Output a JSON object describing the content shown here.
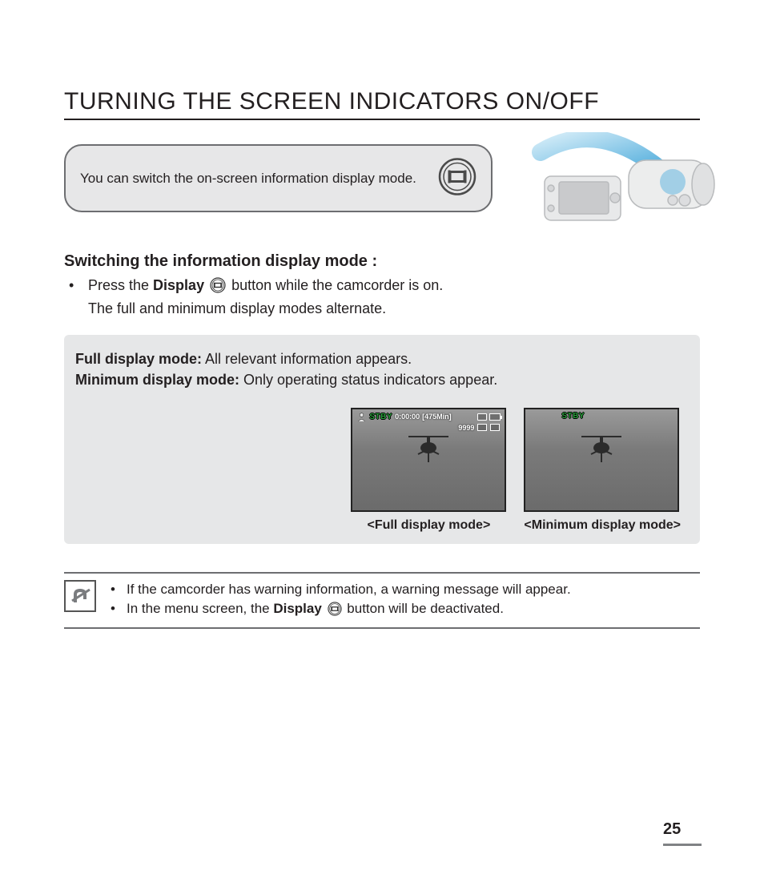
{
  "page": {
    "title": "TURNING THE SCREEN INDICATORS ON/OFF",
    "number": "25"
  },
  "intro": {
    "text": "You can switch the on-screen information display mode."
  },
  "section": {
    "heading": "Switching the information display mode :",
    "line1_a": "Press the ",
    "line1_bold": "Display",
    "line1_b": " button while the camcorder is on.",
    "line2": "The full and minimum display modes alternate."
  },
  "modes": {
    "full_label": "Full display mode:",
    "full_desc": " All relevant information appears.",
    "min_label": "Minimum display mode:",
    "min_desc": " Only operating status indicators appear."
  },
  "screens": {
    "stby": "STBY",
    "time": "0:00:00",
    "remain": "[475Min]",
    "count": "9999",
    "full_caption": "<Full display mode>",
    "min_caption": "<Minimum display mode>"
  },
  "notes": {
    "n1": "If the camcorder has warning information, a warning message will appear.",
    "n2_a": "In the menu screen, the ",
    "n2_bold": "Display",
    "n2_b": " button will be deactivated."
  }
}
